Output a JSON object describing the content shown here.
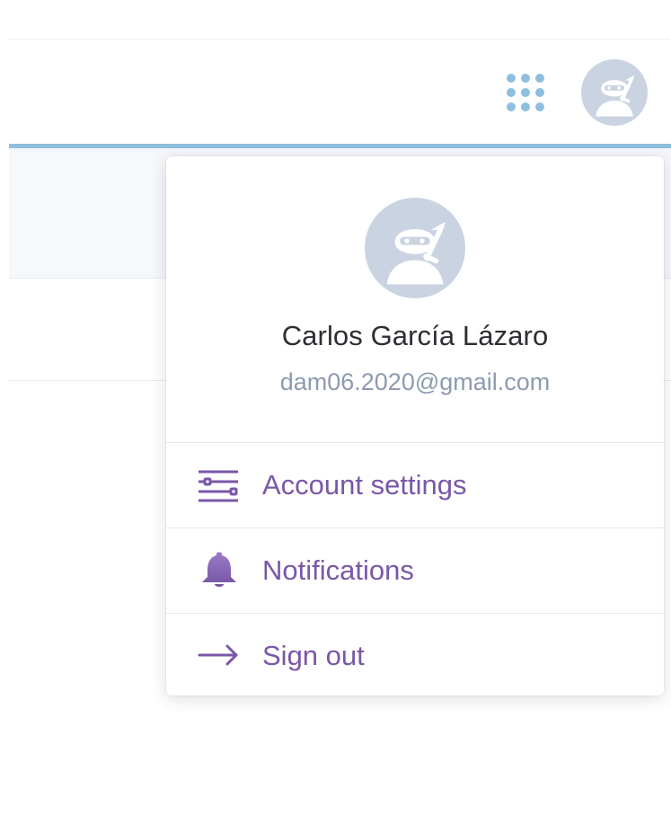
{
  "header": {
    "apps_label": "Apps",
    "avatar_icon": "ninja-avatar-icon"
  },
  "profile": {
    "name": "Carlos García Lázaro",
    "email": "dam06.2020@gmail.com",
    "avatar_icon": "ninja-avatar-icon"
  },
  "menu": {
    "items": [
      {
        "label": "Account settings",
        "icon": "settings-sliders-icon"
      },
      {
        "label": "Notifications",
        "icon": "bell-icon"
      },
      {
        "label": "Sign out",
        "icon": "arrow-right-icon"
      }
    ]
  },
  "colors": {
    "accent_line": "#8ebfdf",
    "apps_dots": "#8ebfdf",
    "avatar_bg": "#c9d3e1",
    "menu_text": "#7a57a8",
    "email_text": "#8d9bb0"
  }
}
